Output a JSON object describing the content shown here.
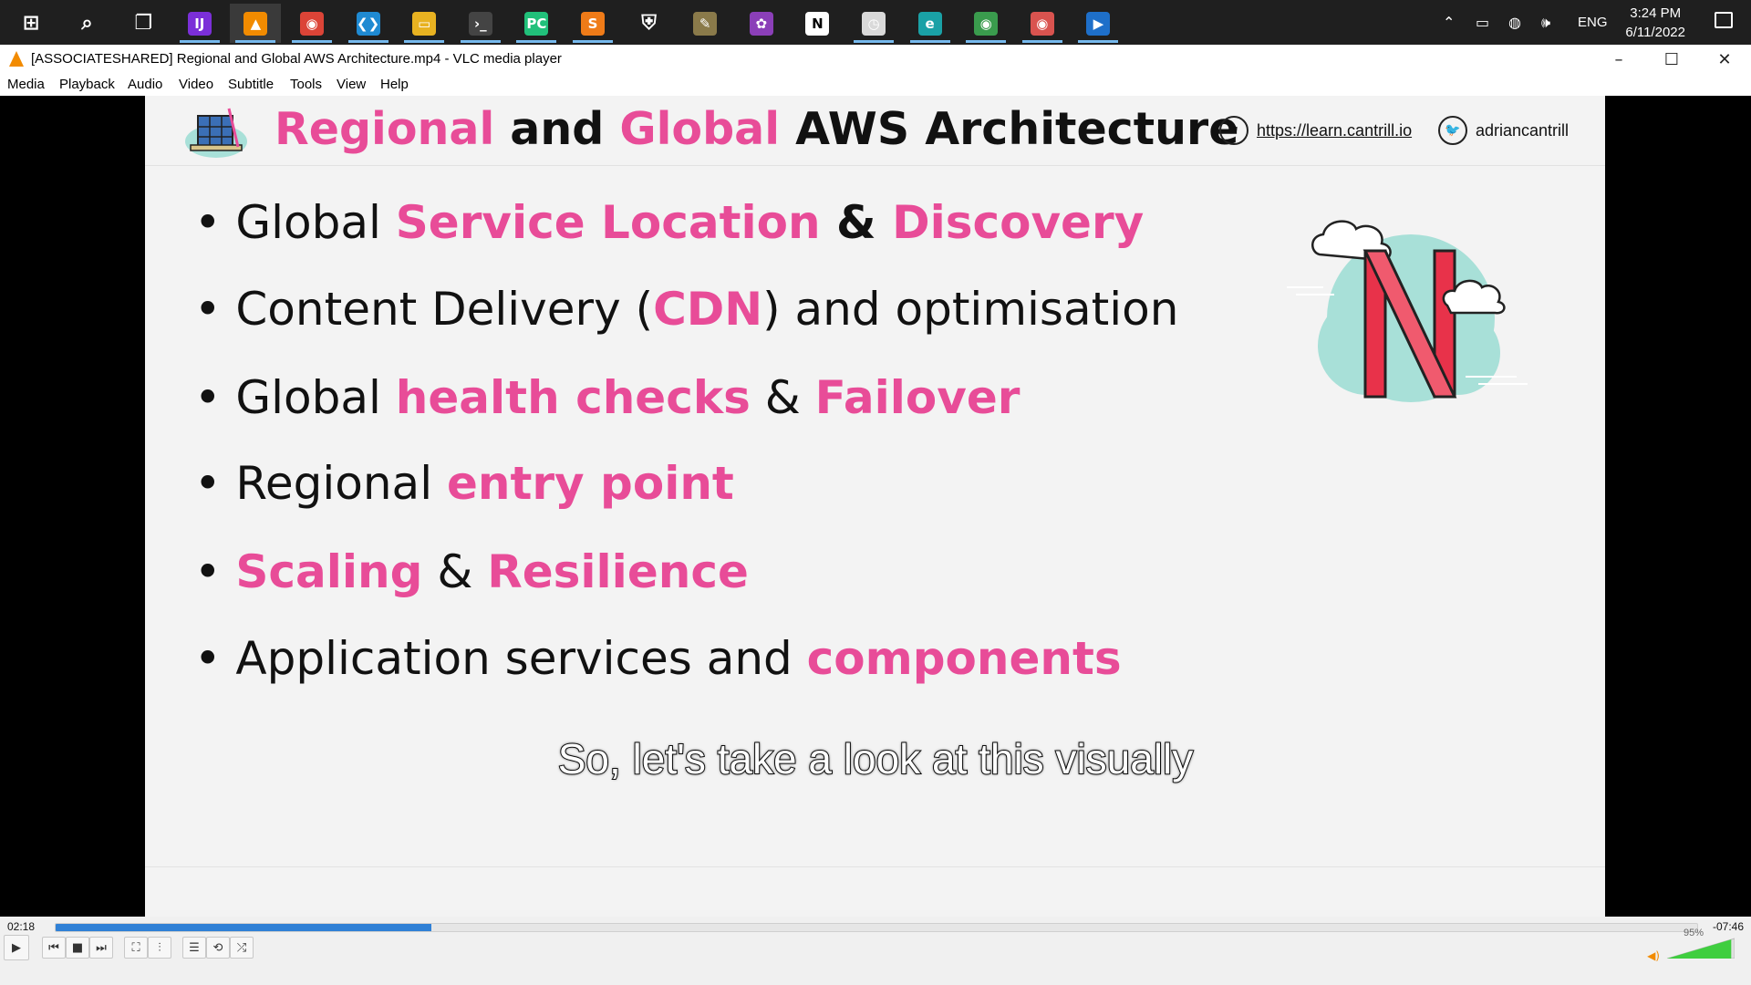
{
  "taskbar": {
    "apps": [
      {
        "name": "start-icon",
        "glyph": "⊞",
        "color": "#1f1f1f",
        "running": false,
        "active": false
      },
      {
        "name": "search-icon",
        "glyph": "⌕",
        "color": "#1f1f1f",
        "running": false,
        "active": false
      },
      {
        "name": "task-view-icon",
        "glyph": "❐",
        "color": "#1f1f1f",
        "running": false,
        "active": false
      },
      {
        "name": "intellij-icon",
        "glyph": "IJ",
        "color": "#7b2fd8",
        "running": true,
        "active": false
      },
      {
        "name": "vlc-icon",
        "glyph": "▲",
        "color": "#f28b00",
        "running": true,
        "active": true
      },
      {
        "name": "chrome-icon",
        "glyph": "◉",
        "color": "#db4437",
        "running": true,
        "active": false
      },
      {
        "name": "vscode-icon",
        "glyph": "❮❯",
        "color": "#1f8ad2",
        "running": true,
        "active": false
      },
      {
        "name": "file-explorer-icon",
        "glyph": "▭",
        "color": "#e8b221",
        "running": true,
        "active": false
      },
      {
        "name": "terminal-icon",
        "glyph": "›_",
        "color": "#444444",
        "running": true,
        "active": false
      },
      {
        "name": "pycharm-icon",
        "glyph": "PC",
        "color": "#21c07a",
        "running": true,
        "active": false
      },
      {
        "name": "sublime-icon",
        "glyph": "S",
        "color": "#ef7b18",
        "running": true,
        "active": false
      },
      {
        "name": "security-shield-icon",
        "glyph": "⛨",
        "color": "#1f1f1f",
        "running": false,
        "active": false
      },
      {
        "name": "notebook-app-icon",
        "glyph": "✎",
        "color": "#8a7a4a",
        "running": false,
        "active": false
      },
      {
        "name": "photos-app-icon",
        "glyph": "✿",
        "color": "#8b3fb8",
        "running": false,
        "active": false
      },
      {
        "name": "notion-icon",
        "glyph": "N",
        "color": "#ffffff",
        "running": false,
        "active": false
      },
      {
        "name": "clock-app-icon",
        "glyph": "◷",
        "color": "#d9d9d9",
        "running": true,
        "active": false
      },
      {
        "name": "edge-icon",
        "glyph": "e",
        "color": "#1aa1a6",
        "running": true,
        "active": false
      },
      {
        "name": "chrome-profile-icon",
        "glyph": "◉",
        "color": "#3a9b4d",
        "running": true,
        "active": false
      },
      {
        "name": "chrome-alt-icon",
        "glyph": "◉",
        "color": "#d9534f",
        "running": true,
        "active": false
      },
      {
        "name": "media-player-icon",
        "glyph": "▶",
        "color": "#1e6fc9",
        "running": true,
        "active": false
      }
    ],
    "tray": {
      "language": "ENG",
      "time": "3:24 PM",
      "date": "6/11/2022"
    }
  },
  "window": {
    "title": "[ASSOCIATESHARED] Regional and Global AWS Architecture.mp4 - VLC media player"
  },
  "menu": [
    "Media",
    "Playback",
    "Audio",
    "Video",
    "Subtitle",
    "Tools",
    "View",
    "Help"
  ],
  "slide": {
    "title_parts": [
      {
        "text": "Regional",
        "accent": true
      },
      {
        "text": " and ",
        "accent": false
      },
      {
        "text": "Global",
        "accent": true
      },
      {
        "text": " AWS Architecture",
        "accent": false
      }
    ],
    "website": "https://learn.cantrill.io",
    "twitter": "adriancantrill",
    "bullets": [
      [
        {
          "t": "Global ",
          "s": "n"
        },
        {
          "t": "Service Location",
          "s": "p"
        },
        {
          "t": " & ",
          "s": "d"
        },
        {
          "t": "Discovery",
          "s": "p"
        }
      ],
      [
        {
          "t": "Content Delivery (",
          "s": "n"
        },
        {
          "t": "CDN",
          "s": "p"
        },
        {
          "t": ") and optimisation",
          "s": "n"
        }
      ],
      [
        {
          "t": "Global ",
          "s": "n"
        },
        {
          "t": "health checks",
          "s": "p"
        },
        {
          "t": " & ",
          "s": "n"
        },
        {
          "t": "Failover",
          "s": "p"
        }
      ],
      [
        {
          "t": "Regional ",
          "s": "n"
        },
        {
          "t": "entry point",
          "s": "p"
        }
      ],
      [
        {
          "t": "Scaling",
          "s": "p"
        },
        {
          "t": " & ",
          "s": "n"
        },
        {
          "t": "Resilience",
          "s": "p"
        }
      ],
      [
        {
          "t": "Application services and ",
          "s": "n"
        },
        {
          "t": "components",
          "s": "p"
        }
      ]
    ],
    "accent_color": "#e84c98"
  },
  "subtitle": "So, let's take a look at this visually",
  "player": {
    "elapsed": "02:18",
    "remaining": "-07:46",
    "progress": 0.229,
    "volume_label": "95%",
    "volume": 0.95
  }
}
